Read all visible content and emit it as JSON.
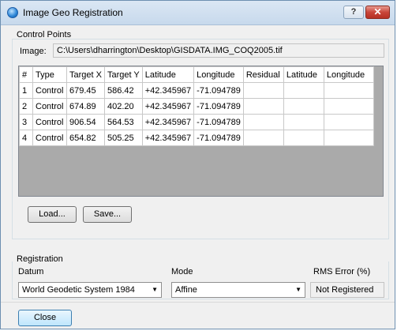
{
  "window": {
    "title": "Image Geo Registration",
    "help_label": "?",
    "close_label": "✕"
  },
  "control_points": {
    "group_label": "Control Points",
    "image_label": "Image:",
    "image_path": "C:\\Users\\dharrington\\Desktop\\GISDATA.IMG_COQ2005.tif",
    "columns": [
      "#",
      "Type",
      "Target X",
      "Target Y",
      "Latitude",
      "Longitude",
      "Residual",
      "Latitude",
      "Longitude"
    ],
    "rows": [
      [
        "1",
        "Control",
        "679.45",
        "586.42",
        "+42.345967",
        "-71.094789",
        "",
        "",
        ""
      ],
      [
        "2",
        "Control",
        "674.89",
        "402.20",
        "+42.345967",
        "-71.094789",
        "",
        "",
        ""
      ],
      [
        "3",
        "Control",
        "906.54",
        "564.53",
        "+42.345967",
        "-71.094789",
        "",
        "",
        ""
      ],
      [
        "4",
        "Control",
        "654.82",
        "505.25",
        "+42.345967",
        "-71.094789",
        "",
        "",
        ""
      ]
    ],
    "load_label": "Load...",
    "save_label": "Save..."
  },
  "registration": {
    "group_label": "Registration",
    "datum_label": "Datum",
    "datum_value": "World Geodetic System 1984",
    "mode_label": "Mode",
    "mode_value": "Affine",
    "rms_label": "RMS Error (%)",
    "rms_value": "Not Registered"
  },
  "footer": {
    "close_label": "Close"
  }
}
